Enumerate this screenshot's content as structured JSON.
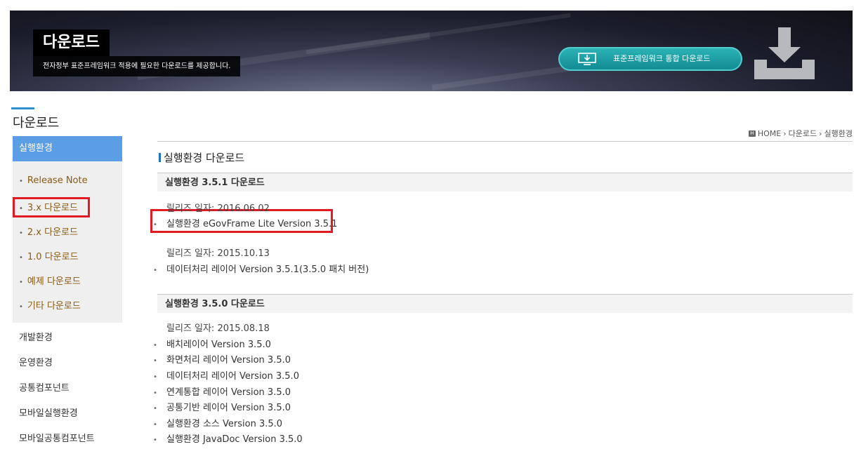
{
  "banner": {
    "title": "다운로드",
    "subtitle": "전자정부 표준프레임워크 적용에 필요한 다운로드를 제공합니다.",
    "integrated_download_button": "표준프레임워크  통합 다운로드"
  },
  "sidebar": {
    "title": "다운로드",
    "active_item": "실행환경",
    "sub_items": [
      {
        "label": "Release Note"
      },
      {
        "label": "3.x 다운로드"
      },
      {
        "label": "2.x 다운로드"
      },
      {
        "label": "1.0 다운로드"
      },
      {
        "label": "예제 다운로드"
      },
      {
        "label": "기타 다운로드"
      }
    ],
    "items": [
      {
        "label": "개발환경"
      },
      {
        "label": "운영환경"
      },
      {
        "label": "공통컴포넌트"
      },
      {
        "label": "모바일실행환경"
      },
      {
        "label": "모바일공통컴포넌트"
      }
    ]
  },
  "breadcrumb": {
    "home": "HOME",
    "items": [
      "다운로드",
      "실행환경"
    ]
  },
  "main": {
    "title": "실행환경 다운로드",
    "sections": [
      {
        "heading": "실행환경 3.5.1 다운로드",
        "releases": [
          {
            "date": "릴리즈 일자: 2016.06.02",
            "items": [
              "실행환경 eGovFrame Lite Version 3.5.1"
            ]
          },
          {
            "date": "릴리즈 일자: 2015.10.13",
            "items": [
              "데이터처리 레이어 Version 3.5.1(3.5.0 패치 버전)"
            ]
          }
        ]
      },
      {
        "heading": "실행환경 3.5.0 다운로드",
        "releases": [
          {
            "date": "릴리즈 일자: 2015.08.18",
            "items": [
              "배치레이어 Version 3.5.0",
              "화면처리 레이어 Version 3.5.0",
              "데이터처리 레이어 Version 3.5.0",
              "연계통합 레이어 Version 3.5.0",
              "공통기반 레이어 Version 3.5.0",
              "실행환경 소스 Version 3.5.0",
              "실행환경 JavaDoc Version 3.5.0"
            ]
          }
        ]
      }
    ]
  },
  "colors": {
    "accent_blue": "#5b9ee6",
    "teal_button": "#1a9ea3",
    "highlight_red": "#e01b24",
    "submenu_text": "#8a5a12"
  }
}
